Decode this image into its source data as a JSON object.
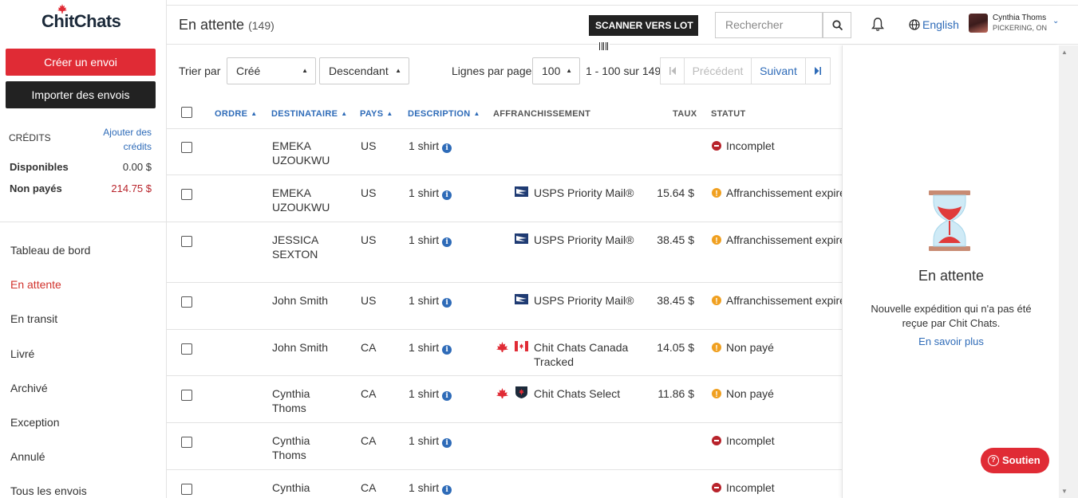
{
  "brand": {
    "name": "ChitChats",
    "accent": "#e02b35",
    "link": "#2e6bb8"
  },
  "sidebar": {
    "create_label": "Créer un envoi",
    "import_label": "Importer des envois",
    "credits_label": "CRÉDITS",
    "add_credits_label": "Ajouter des crédits",
    "available_label": "Disponibles",
    "available_value": "0.00 $",
    "unpaid_label": "Non payés",
    "unpaid_value": "214.75 $",
    "nav": [
      {
        "label": "Tableau de bord"
      },
      {
        "label": "En attente"
      },
      {
        "label": "En transit"
      },
      {
        "label": "Livré"
      },
      {
        "label": "Archivé"
      },
      {
        "label": "Exception"
      },
      {
        "label": "Annulé"
      },
      {
        "label": "Tous les envois"
      }
    ]
  },
  "header": {
    "title": "En attente",
    "count": "(149)",
    "scan_label": "SCANNER VERS LOT",
    "search_placeholder": "Rechercher",
    "language": "English",
    "user_name": "Cynthia Thoms",
    "user_location": "PICKERING, ON"
  },
  "toolbar": {
    "sort_by_label": "Trier par",
    "sort_field": "Créé",
    "sort_order": "Descendant",
    "rows_per_page_label": "Lignes par page",
    "rows_per_page": "100",
    "range": "1 - 100 sur 149",
    "prev_label": "Précédent",
    "next_label": "Suivant"
  },
  "table": {
    "columns": {
      "order": "ORDRE",
      "recipient": "DESTINATAIRE",
      "country": "PAYS",
      "description": "DESCRIPTION",
      "postage": "AFFRANCHISSEMENT",
      "rate": "TAUX",
      "status": "STATUT"
    },
    "rows": [
      {
        "recipient": "EMEKA UZOUKWU",
        "country": "US",
        "description": "1 shirt",
        "postage": "",
        "carrier": "",
        "rate": "",
        "status": "Incomplet",
        "status_type": "red"
      },
      {
        "recipient": "EMEKA UZOUKWU",
        "country": "US",
        "description": "1 shirt",
        "postage": "USPS Priority Mail®",
        "carrier": "usps",
        "rate": "15.64 $",
        "status": "Affranchissement expiré",
        "status_type": "orange"
      },
      {
        "recipient": "JESSICA SEXTON",
        "country": "US",
        "description": "1 shirt",
        "postage": "USPS Priority Mail®",
        "carrier": "usps",
        "rate": "38.45 $",
        "status": "Affranchissement expiré",
        "status_type": "orange"
      },
      {
        "recipient": "John Smith",
        "country": "US",
        "description": "1 shirt",
        "postage": "USPS Priority Mail®",
        "carrier": "usps",
        "rate": "38.45 $",
        "status": "Affranchissement expiré",
        "status_type": "orange"
      },
      {
        "recipient": "John Smith",
        "country": "CA",
        "description": "1 shirt",
        "postage": "Chit Chats Canada Tracked",
        "carrier": "canada",
        "rate": "14.05 $",
        "status": "Non payé",
        "status_type": "orange"
      },
      {
        "recipient": "Cynthia Thoms",
        "country": "CA",
        "description": "1 shirt",
        "postage": "Chit Chats Select",
        "carrier": "select",
        "rate": "11.86 $",
        "status": "Non payé",
        "status_type": "orange"
      },
      {
        "recipient": "Cynthia Thoms",
        "country": "CA",
        "description": "1 shirt",
        "postage": "",
        "carrier": "",
        "rate": "",
        "status": "Incomplet",
        "status_type": "red"
      },
      {
        "recipient": "Cynthia Thoms",
        "country": "CA",
        "description": "1 shirt",
        "postage": "",
        "carrier": "",
        "rate": "",
        "status": "Incomplet",
        "status_type": "red"
      }
    ]
  },
  "panel": {
    "title": "En attente",
    "description": "Nouvelle expédition qui n'a pas été reçue par Chit Chats.",
    "link": "En savoir plus"
  },
  "support_label": "Soutien"
}
